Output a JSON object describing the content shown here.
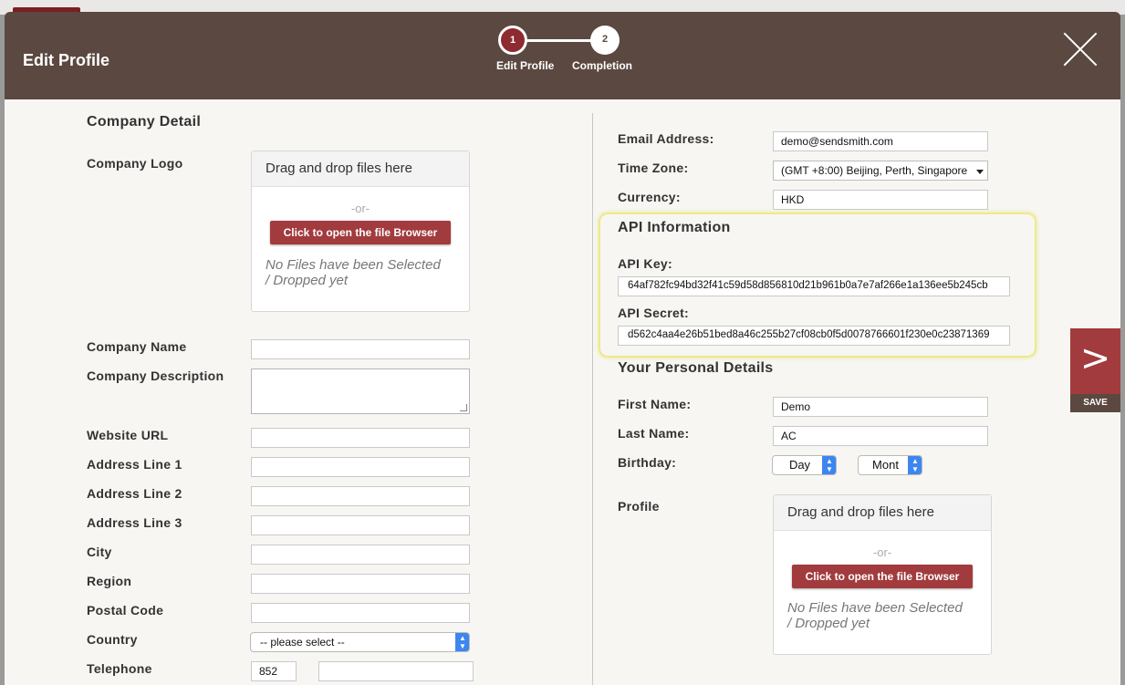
{
  "header": {
    "title": "Edit Profile",
    "steps": [
      {
        "number": "1",
        "label": "Edit Profile"
      },
      {
        "number": "2",
        "label": "Completion"
      }
    ]
  },
  "company": {
    "section_title": "Company Detail",
    "logo_label": "Company Logo",
    "dropzone": {
      "heading": "Drag and drop files here",
      "or_text": "-or-",
      "button": "Click to open the file Browser",
      "empty_line1": "No Files have been Selected",
      "empty_line2": "/ Dropped yet"
    },
    "fields": {
      "name": {
        "label": "Company Name",
        "value": ""
      },
      "description": {
        "label": "Company Description",
        "value": ""
      },
      "website": {
        "label": "Website URL",
        "value": ""
      },
      "address1": {
        "label": "Address Line 1",
        "value": ""
      },
      "address2": {
        "label": "Address Line 2",
        "value": ""
      },
      "address3": {
        "label": "Address Line 3",
        "value": ""
      },
      "city": {
        "label": "City",
        "value": ""
      },
      "region": {
        "label": "Region",
        "value": ""
      },
      "postal": {
        "label": "Postal Code",
        "value": ""
      },
      "country": {
        "label": "Country",
        "value": "-- please select --"
      },
      "telephone": {
        "label": "Telephone",
        "code": "852",
        "value": ""
      }
    }
  },
  "account": {
    "email": {
      "label": "Email Address:",
      "value": "demo@sendsmith.com"
    },
    "timezone": {
      "label": "Time Zone:",
      "value": "(GMT +8:00) Beijing, Perth, Singapore"
    },
    "currency": {
      "label": "Currency:",
      "value": "HKD"
    }
  },
  "api": {
    "section_title": "API Information",
    "key_label": "API Key:",
    "key_value": "64af782fc94bd32f41c59d58d856810d21b961b0a7e7af266e1a136ee5b245cb",
    "secret_label": "API Secret:",
    "secret_value": "d562c4aa4e26b51bed8a46c255b27cf08cb0f5d0078766601f230e0c23871369"
  },
  "personal": {
    "section_title": "Your Personal Details",
    "first_name": {
      "label": "First Name:",
      "value": "Demo"
    },
    "last_name": {
      "label": "Last Name:",
      "value": "AC"
    },
    "birthday": {
      "label": "Birthday:",
      "day": "Day",
      "month": "Mont"
    },
    "profile_label": "Profile",
    "dropzone": {
      "heading": "Drag and drop files here",
      "or_text": "-or-",
      "button": "Click to open the file Browser",
      "empty_line1": "No Files have been Selected",
      "empty_line2": "/ Dropped yet"
    }
  },
  "save": {
    "arrow": ">",
    "label": "SAVE"
  },
  "colors": {
    "header_bg": "#5b4841",
    "accent": "#a23b3d",
    "step_active": "#8d2b30",
    "highlight": "#efe98a"
  },
  "icons": {
    "close": "close-icon",
    "save": "chevron-right-icon",
    "select": "chevron-down-icon",
    "stepper": "up-down-stepper-icon"
  }
}
